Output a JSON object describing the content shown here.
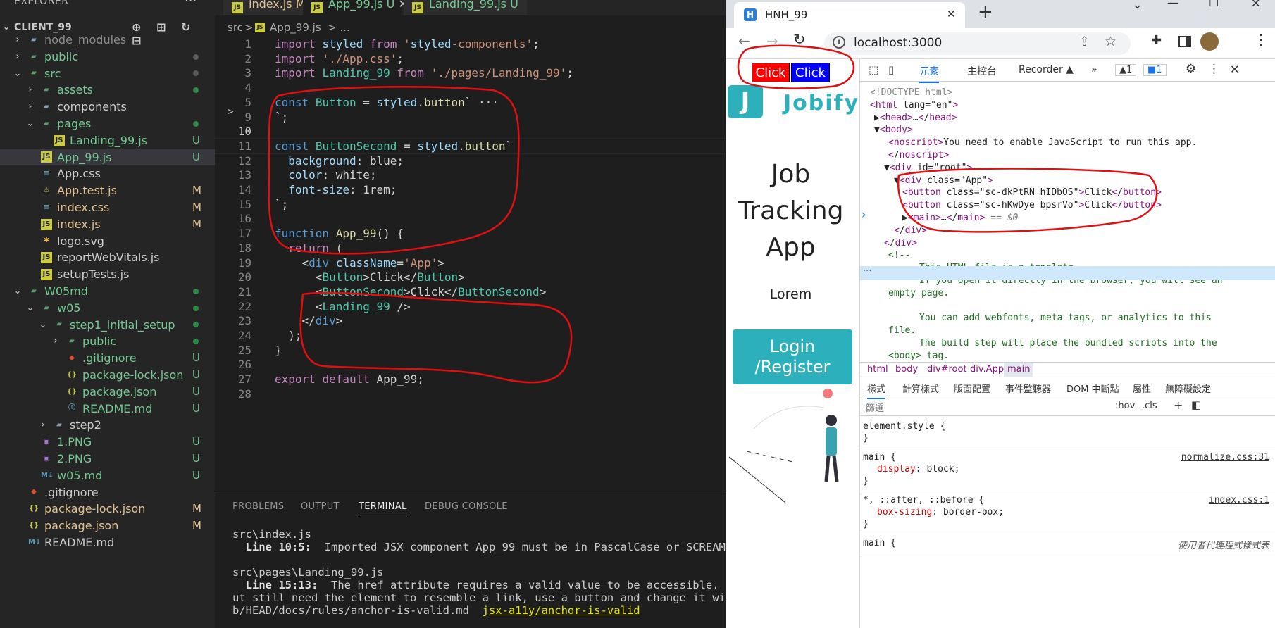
{
  "explorer": {
    "title": "EXPLORER",
    "more": "···",
    "root": "CLIENT_99",
    "actions": "⊕ ⊞ ↻ ⊟",
    "items": [
      {
        "label": "node_modules",
        "status": "",
        "dot": "",
        "color": "#8c8c8c"
      },
      {
        "label": "public",
        "status": "",
        "dot": "#5a5a5a",
        "color": "#73c991"
      },
      {
        "label": "src",
        "status": "",
        "dot": "#5a5a5a",
        "color": "#73c991"
      },
      {
        "label": "assets",
        "status": "",
        "dot": "#2f8a4a",
        "color": "#73c991"
      },
      {
        "label": "components",
        "status": "",
        "dot": "",
        "color": "#cccccc"
      },
      {
        "label": "pages",
        "status": "",
        "dot": "#2f8a4a",
        "color": "#73c991"
      },
      {
        "label": "Landing_99.js",
        "status": "U",
        "dot": "",
        "color": "#73c991"
      },
      {
        "label": "App_99.js",
        "status": "U",
        "dot": "",
        "color": "#73c991"
      },
      {
        "label": "App.css",
        "status": "",
        "dot": "",
        "color": "#cccccc"
      },
      {
        "label": "App.test.js",
        "status": "M",
        "dot": "",
        "color": "#e2c08d"
      },
      {
        "label": "index.css",
        "status": "M",
        "dot": "",
        "color": "#e2c08d"
      },
      {
        "label": "index.js",
        "status": "M",
        "dot": "",
        "color": "#e2c08d"
      },
      {
        "label": "logo.svg",
        "status": "",
        "dot": "",
        "color": "#cccccc"
      },
      {
        "label": "reportWebVitals.js",
        "status": "",
        "dot": "",
        "color": "#cccccc"
      },
      {
        "label": "setupTests.js",
        "status": "",
        "dot": "",
        "color": "#cccccc"
      },
      {
        "label": "W05md",
        "status": "",
        "dot": "#2f8a4a",
        "color": "#73c991"
      },
      {
        "label": "w05",
        "status": "",
        "dot": "#2f8a4a",
        "color": "#73c991"
      },
      {
        "label": "step1_initial_setup",
        "status": "",
        "dot": "#2f8a4a",
        "color": "#73c991"
      },
      {
        "label": "public",
        "status": "",
        "dot": "#2f8a4a",
        "color": "#73c991"
      },
      {
        "label": ".gitignore",
        "status": "U",
        "dot": "",
        "color": "#73c991"
      },
      {
        "label": "package-lock.json",
        "status": "U",
        "dot": "",
        "color": "#73c991"
      },
      {
        "label": "package.json",
        "status": "U",
        "dot": "",
        "color": "#73c991"
      },
      {
        "label": "README.md",
        "status": "U",
        "dot": "",
        "color": "#73c991"
      },
      {
        "label": "step2",
        "status": "",
        "dot": "",
        "color": "#cccccc"
      },
      {
        "label": "1.PNG",
        "status": "U",
        "dot": "",
        "color": "#73c991"
      },
      {
        "label": "2.PNG",
        "status": "U",
        "dot": "",
        "color": "#73c991"
      },
      {
        "label": "w05.md",
        "status": "U",
        "dot": "",
        "color": "#73c991"
      },
      {
        "label": ".gitignore",
        "status": "",
        "dot": "",
        "color": "#cccccc"
      },
      {
        "label": "package-lock.json",
        "status": "M",
        "dot": "",
        "color": "#e2c08d"
      },
      {
        "label": "package.json",
        "status": "M",
        "dot": "",
        "color": "#e2c08d"
      },
      {
        "label": "README.md",
        "status": "",
        "dot": "",
        "color": "#cccccc"
      }
    ]
  },
  "tabs": [
    {
      "label": "index.js",
      "status": "M"
    },
    {
      "label": "App_99.js",
      "status": "U",
      "close": "✕"
    },
    {
      "label": "Landing_99.js",
      "status": "U"
    }
  ],
  "breadcrumb": {
    "dir": "src",
    "sep": ">",
    "file": "App_99.js",
    "tail": "> ..."
  },
  "editor": {
    "line_numbers": [
      "1",
      "2",
      "3",
      "4",
      "5",
      "9",
      "10",
      "11",
      "12",
      "13",
      "14",
      "15",
      "16",
      "17",
      "18",
      "19",
      "20",
      "21",
      "22",
      "23",
      "24",
      "25",
      "26",
      "27",
      "28"
    ],
    "lines": [
      "import styled from 'styled-components';",
      "import './App.css';",
      "import Landing_99 from './pages/Landing_99';",
      "",
      "const Button = styled.button` ···",
      "`;",
      "",
      "const ButtonSecond = styled.button`",
      "  background: blue;",
      "  color: white;",
      "  font-size: 1rem;",
      "`;",
      "",
      "function App_99() {",
      "  return (",
      "    <div className='App'>",
      "      <Button>Click</Button>",
      "      <ButtonSecond>Click</ButtonSecond>",
      "      <Landing_99 />",
      "    </div>",
      "  );",
      "}",
      "",
      "export default App_99;",
      ""
    ]
  },
  "panel": {
    "tabs": [
      "PROBLEMS",
      "OUTPUT",
      "TERMINAL",
      "DEBUG CONSOLE"
    ],
    "active": "TERMINAL",
    "lines": [
      "src\\index.js",
      "  Line 10:5:  Imported JSX component App_99 must be in PascalCase or SCREAMING",
      "",
      "src\\pages\\Landing_99.js",
      "  Line 15:13:  The href attribute requires a valid value to be accessible. Pro",
      "ut still need the element to resemble a link, use a button and change it with",
      "b/HEAD/docs/rules/anchor-is-valid.md  "
    ],
    "link": "jsx-a11y/anchor-is-valid"
  },
  "browser": {
    "tab_title": "HNH_99",
    "tab_close": "✕",
    "new_tab": "+",
    "url": "localhost:3000",
    "window": {
      "min": "—",
      "max": "☐",
      "close": "✕",
      "chev": "⌄"
    }
  },
  "page": {
    "buttons": [
      "Click",
      "Click"
    ],
    "logo_letter": "J",
    "logo_text": "Jobify",
    "hero": [
      "Job",
      "Tracking",
      "App"
    ],
    "lorem": "Lorem",
    "cta": [
      "Login",
      "/Register"
    ]
  },
  "devtools": {
    "tabs": [
      "元素",
      "主控台",
      "Recorder ▲",
      "»"
    ],
    "badges": [
      "▲1",
      "■1"
    ],
    "dom": [
      "<!DOCTYPE html>",
      "<html lang=\"en\">",
      "▶<head>…</head>",
      "▼<body>",
      "<noscript>You need to enable JavaScript to run this app.",
      "</noscript>",
      "▼<div id=\"root\">",
      "▼<div class=\"App\">",
      "<button class=\"sc-dkPtRN hIDbOS\">Click</button>",
      "<button class=\"sc-hKwDye bpsrVo\">Click</button>",
      "▶<main>…</main> == $0",
      "</div>",
      "</div>",
      "<!--",
      "This HTML file is a template.",
      "If you open it directly in the browser, you will see an",
      "empty page.",
      "",
      "You can add webfonts, meta tags, or analytics to this",
      "file.",
      "The build step will place the bundled scripts into the",
      "<body> tag."
    ],
    "crumbs": [
      "html",
      "body",
      "div#root",
      "div.App",
      "main"
    ],
    "style_tabs": [
      "樣式",
      "計算樣式",
      "版面配置",
      "事件監聽器",
      "DOM 中斷點",
      "屬性",
      "無障礙設定"
    ],
    "filter": "篩選",
    "hov": ":hov",
    "cls": ".cls",
    "styles": [
      {
        "sel": "element.style {",
        "src": "",
        "props": [],
        "close": "}"
      },
      {
        "sel": "main {",
        "src": "normalize.css:31",
        "props": [
          [
            "display",
            "block;"
          ]
        ],
        "close": "}"
      },
      {
        "sel": "*, ::after, ::before {",
        "src": "index.css:1",
        "props": [
          [
            "box-sizing",
            "border-box;"
          ]
        ],
        "close": "}"
      },
      {
        "sel": "main {",
        "src": "使用者代理程式樣式表",
        "props": [],
        "close": ""
      }
    ]
  },
  "colors": {
    "annotation": "#e01010",
    "vscode_bg": "#1e1e1e",
    "teal": "#2cb1bc"
  }
}
